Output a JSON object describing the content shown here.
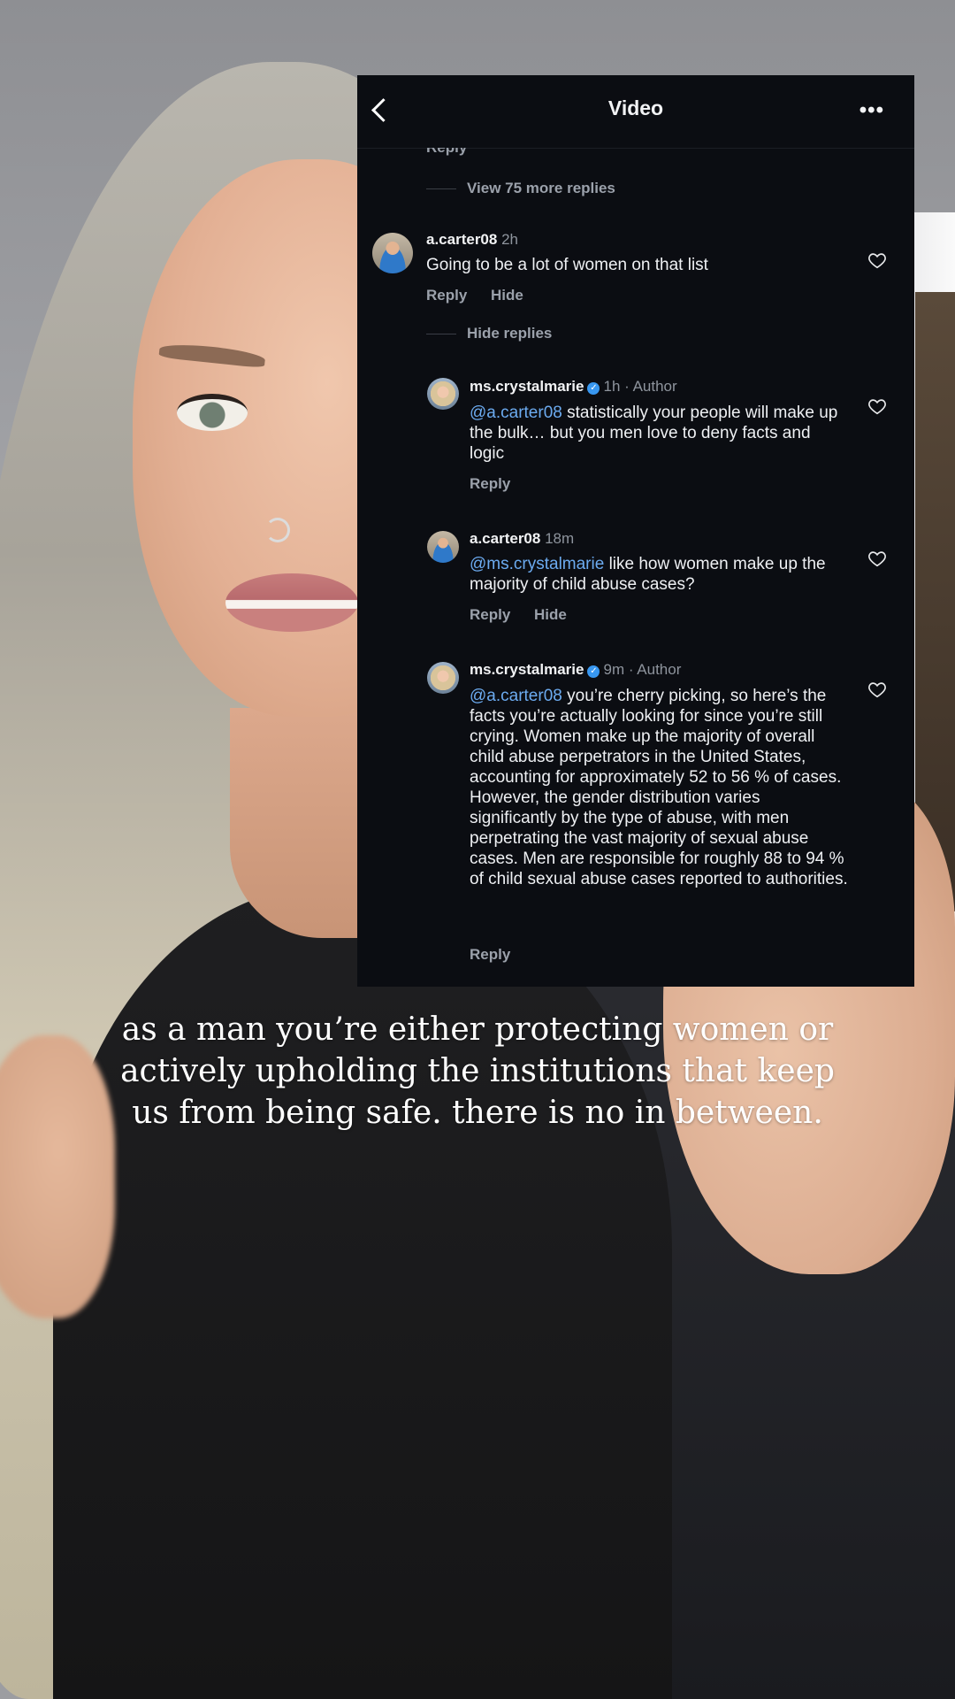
{
  "header": {
    "title": "Video"
  },
  "thread": {
    "cutoff_label": "Reply",
    "view_more_replies": "View 75 more replies",
    "hide_replies": "Hide replies"
  },
  "comments": [
    {
      "user": "a.carter08",
      "time": "2h",
      "text": "Going to be a lot of women on that list",
      "reply_label": "Reply",
      "hide_label": "Hide"
    },
    {
      "user": "ms.crystalmarie",
      "time": "1h · Author",
      "mention": "@a.carter08",
      "text": " statistically your people will make up the bulk… but you men love to deny facts and logic",
      "reply_label": "Reply"
    },
    {
      "user": "a.carter08",
      "time": "18m",
      "mention": "@ms.crystalmarie",
      "text": " like how women make up the majority of child abuse cases?",
      "reply_label": "Reply",
      "hide_label": "Hide"
    },
    {
      "user": "ms.crystalmarie",
      "time": "9m · Author",
      "mention": "@a.carter08",
      "text": " you’re cherry picking, so here’s the facts you’re actually looking for since you’re still crying.  Women make up the majority of overall child abuse perpetrators in the United States, accounting for approximately 52 to 56 % of cases. However, the gender distribution varies significantly by the type of abuse, with men perpetrating the vast majority of sexual abuse cases.  Men are responsible for roughly 88 to 94 % of child sexual abuse cases reported to authorities.",
      "reply_label": "Reply"
    }
  ],
  "caption": "as a man you’re either protecting women or actively upholding the institutions that keep us from being safe.  there is no in between.",
  "colors": {
    "panel_bg": "#0b0d12",
    "mention": "#6cabf0",
    "verified": "#3897f0"
  }
}
